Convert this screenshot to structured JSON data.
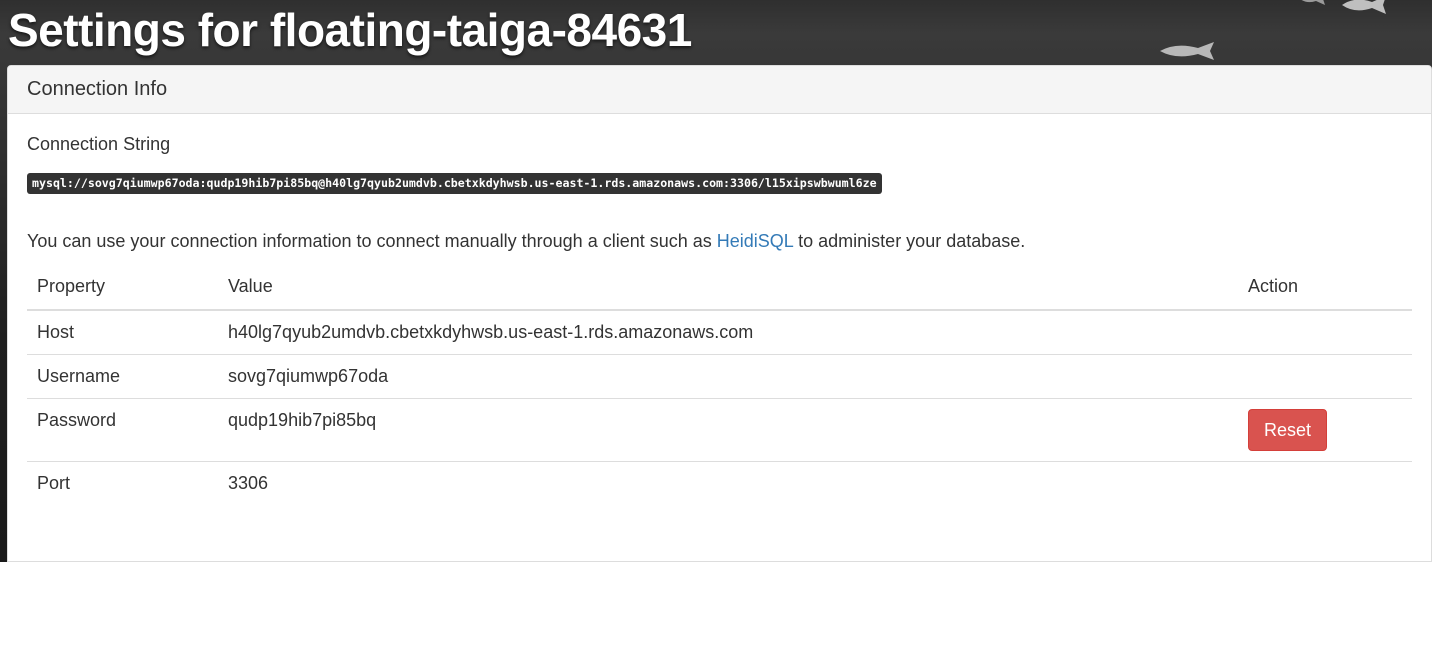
{
  "header": {
    "title": "Settings for floating-taiga-84631"
  },
  "panel": {
    "title": "Connection Info",
    "connection_string_label": "Connection String",
    "connection_string": "mysql://sovg7qiumwp67oda:qudp19hib7pi85bq@h40lg7qyub2umdvb.cbetxkdyhwsb.us-east-1.rds.amazonaws.com:3306/l15xipswbwuml6ze",
    "help": {
      "before": "You can use your connection information to connect manually through a client such as ",
      "link": "HeidiSQL",
      "after": " to administer your database."
    },
    "table": {
      "headers": {
        "property": "Property",
        "value": "Value",
        "action": "Action"
      },
      "rows": [
        {
          "property": "Host",
          "value": "h40lg7qyub2umdvb.cbetxkdyhwsb.us-east-1.rds.amazonaws.com"
        },
        {
          "property": "Username",
          "value": "sovg7qiumwp67oda"
        },
        {
          "property": "Password",
          "value": "qudp19hib7pi85bq",
          "action": "Reset"
        },
        {
          "property": "Port",
          "value": "3306"
        }
      ]
    }
  },
  "colors": {
    "link": "#337ab7",
    "danger": "#d9534f",
    "code_bg": "#333333"
  }
}
